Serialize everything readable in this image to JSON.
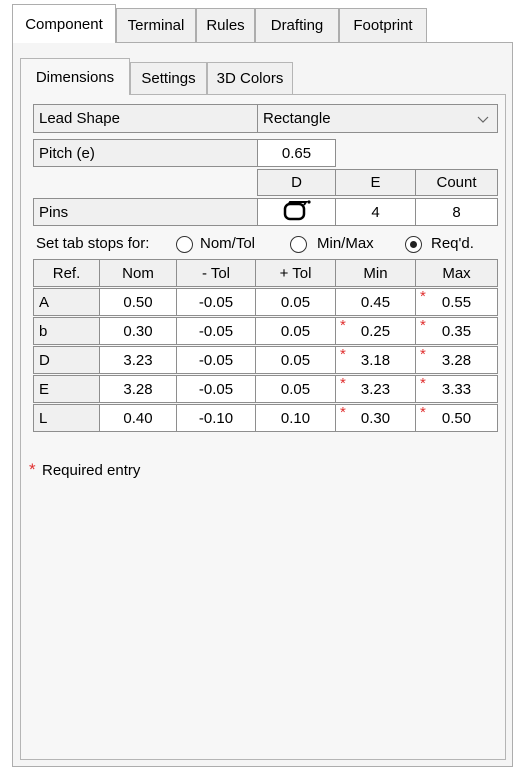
{
  "top_tabs": [
    "Component",
    "Terminal",
    "Rules",
    "Drafting",
    "Footprint"
  ],
  "sub_tabs": [
    "Dimensions",
    "Settings",
    "3D Colors"
  ],
  "lead_shape": {
    "label": "Lead Shape",
    "value": "Rectangle"
  },
  "pitch": {
    "label": "Pitch (e)",
    "value": "0.65"
  },
  "pins": {
    "headers": [
      "D",
      "E",
      "Count"
    ],
    "label": "Pins",
    "d_icon": "pin-shape-icon",
    "e_value": "4",
    "count_value": "8"
  },
  "tab_stops": {
    "label": "Set tab stops for:",
    "options": [
      "Nom/Tol",
      "Min/Max",
      "Req'd."
    ],
    "selected": "Req'd."
  },
  "table": {
    "headers": [
      "Ref.",
      "Nom",
      "- Tol",
      "+ Tol",
      "Min",
      "Max"
    ],
    "rows": [
      {
        "ref": "A",
        "nom": "0.50",
        "minus_tol": "-0.05",
        "plus_tol": "0.05",
        "min": "0.45",
        "max": "0.55",
        "min_required": false,
        "max_required": true
      },
      {
        "ref": "b",
        "nom": "0.30",
        "minus_tol": "-0.05",
        "plus_tol": "0.05",
        "min": "0.25",
        "max": "0.35",
        "min_required": true,
        "max_required": true
      },
      {
        "ref": "D",
        "nom": "3.23",
        "minus_tol": "-0.05",
        "plus_tol": "0.05",
        "min": "3.18",
        "max": "3.28",
        "min_required": true,
        "max_required": true
      },
      {
        "ref": "E",
        "nom": "3.28",
        "minus_tol": "-0.05",
        "plus_tol": "0.05",
        "min": "3.23",
        "max": "3.33",
        "min_required": true,
        "max_required": true
      },
      {
        "ref": "L",
        "nom": "0.40",
        "minus_tol": "-0.10",
        "plus_tol": "0.10",
        "min": "0.30",
        "max": "0.50",
        "min_required": true,
        "max_required": true
      }
    ]
  },
  "required_note": {
    "marker": "*",
    "text": "Required entry"
  },
  "colors": {
    "required_marker": "#e03030"
  }
}
